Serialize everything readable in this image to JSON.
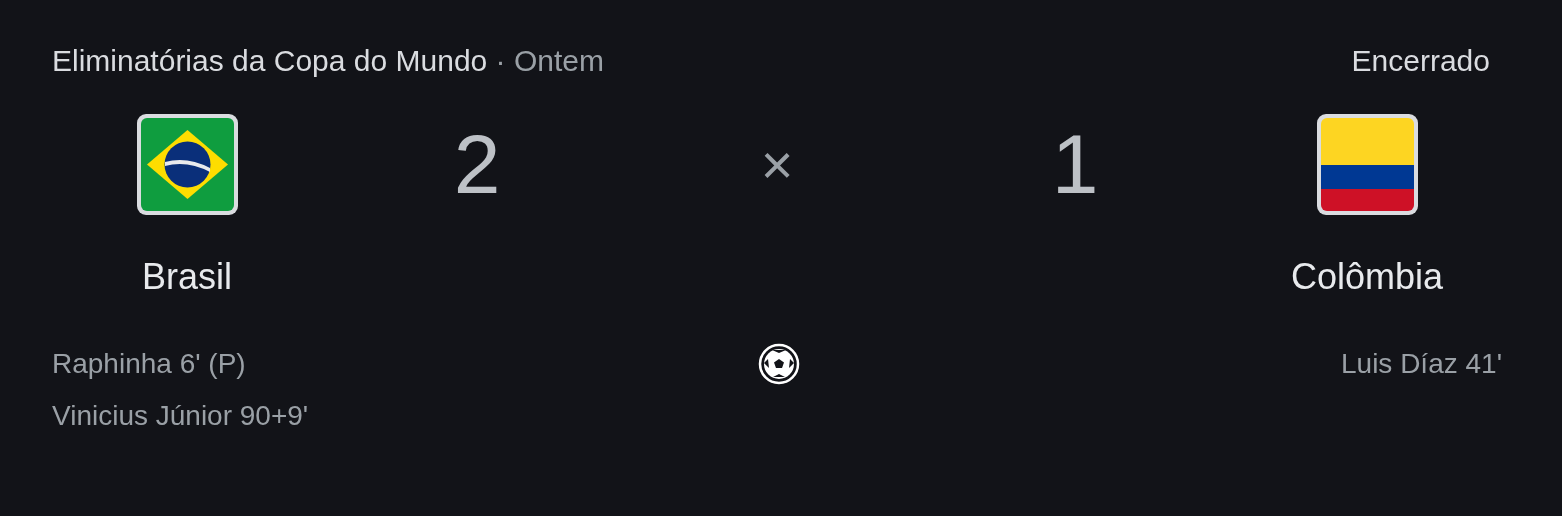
{
  "header": {
    "competition": "Eliminatórias da Copa do Mundo",
    "separator": "·",
    "date": "Ontem",
    "status": "Encerrado"
  },
  "teams": [
    {
      "name": "Brasil",
      "score": "2"
    },
    {
      "name": "Colômbia",
      "score": "1"
    }
  ],
  "score_separator": "×",
  "goals": [
    [
      "Raphinha 6' (P)",
      "Vinicius Júnior 90+9'"
    ],
    [
      "Luis Díaz 41'"
    ]
  ]
}
